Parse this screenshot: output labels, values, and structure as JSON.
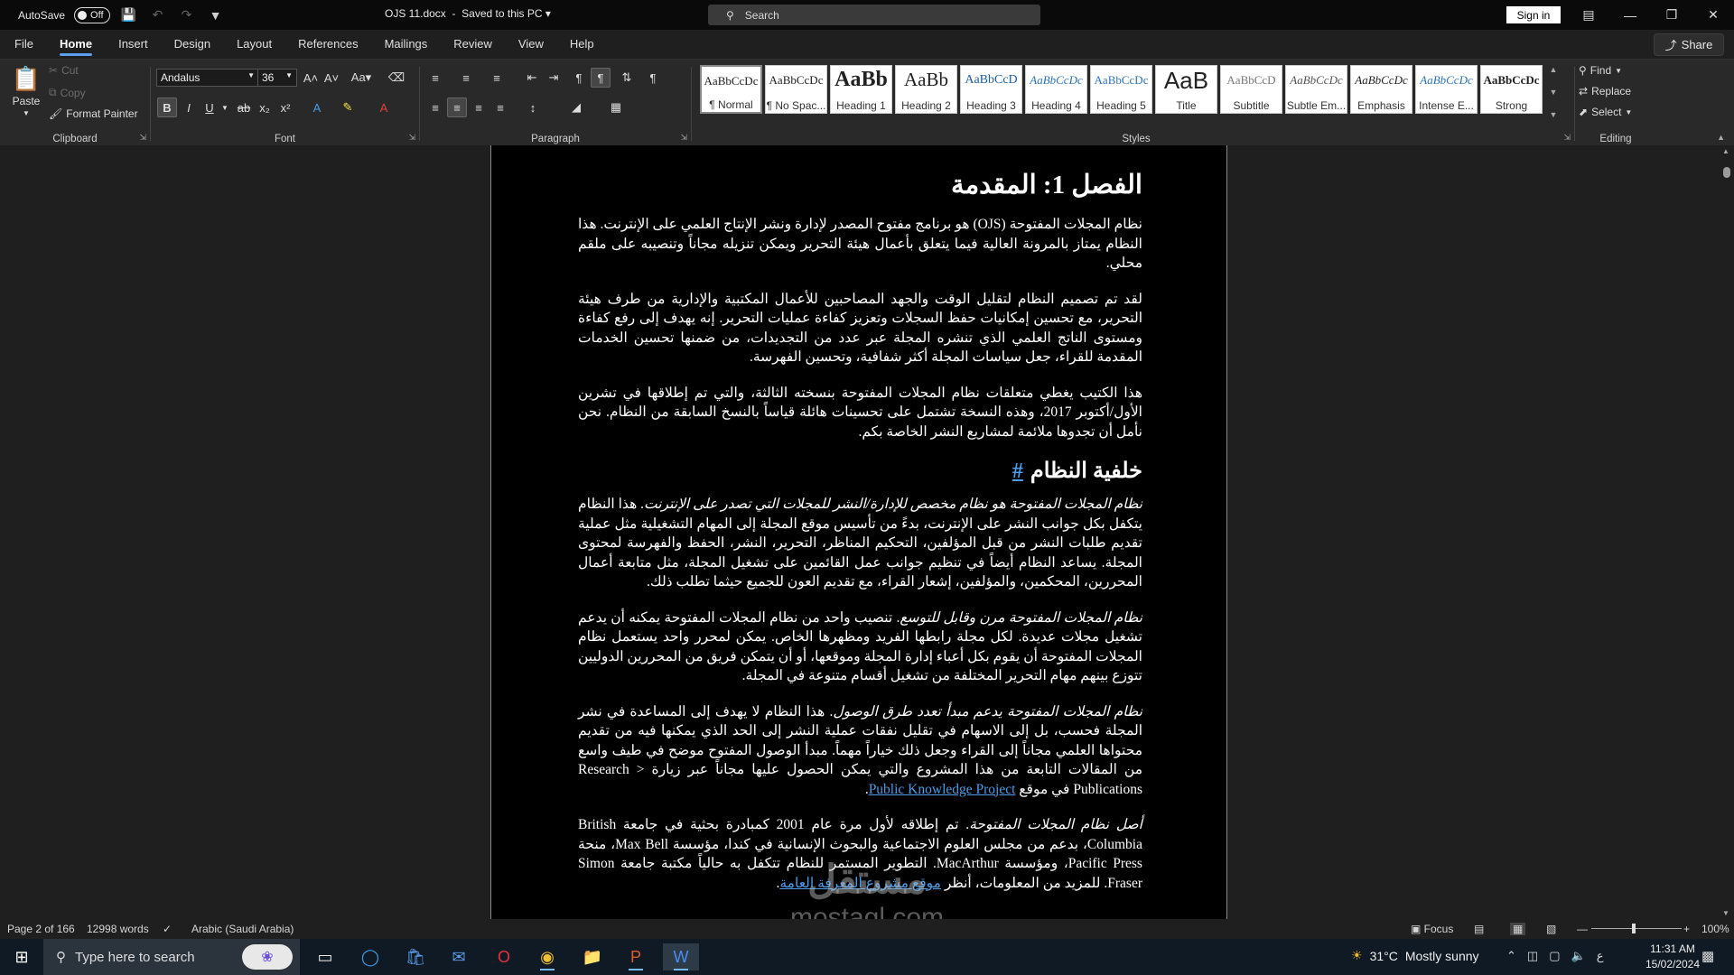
{
  "titlebar": {
    "autosave_label": "AutoSave",
    "autosave_state": "Off",
    "doc_title": "OJS 11.docx",
    "save_status": "Saved to this PC",
    "search_placeholder": "Search",
    "signin_label": "Sign in"
  },
  "tabs": [
    "File",
    "Home",
    "Insert",
    "Design",
    "Layout",
    "References",
    "Mailings",
    "Review",
    "View",
    "Help"
  ],
  "share_label": "Share",
  "ribbon": {
    "clipboard": {
      "label": "Clipboard",
      "paste": "Paste",
      "cut": "Cut",
      "copy": "Copy",
      "format_painter": "Format Painter"
    },
    "font": {
      "label": "Font",
      "family": "Andalus",
      "size": "36"
    },
    "paragraph": {
      "label": "Paragraph"
    },
    "styles": {
      "label": "Styles",
      "items": [
        {
          "preview": "AaBbCcDc",
          "name": "¶ Normal"
        },
        {
          "preview": "AaBbCcDc",
          "name": "¶ No Spac..."
        },
        {
          "preview": "AaBb",
          "name": "Heading 1"
        },
        {
          "preview": "AaBb",
          "name": "Heading 2"
        },
        {
          "preview": "AaBbCcD",
          "name": "Heading 3"
        },
        {
          "preview": "AaBbCcDc",
          "name": "Heading 4"
        },
        {
          "preview": "AaBbCcDc",
          "name": "Heading 5"
        },
        {
          "preview": "AaB",
          "name": "Title"
        },
        {
          "preview": "AaBbCcD",
          "name": "Subtitle"
        },
        {
          "preview": "AaBbCcDc",
          "name": "Subtle Em..."
        },
        {
          "preview": "AaBbCcDc",
          "name": "Emphasis"
        },
        {
          "preview": "AaBbCcDc",
          "name": "Intense E..."
        },
        {
          "preview": "AaBbCcDc",
          "name": "Strong"
        }
      ]
    },
    "editing": {
      "label": "Editing",
      "find": "Find",
      "replace": "Replace",
      "select": "Select"
    }
  },
  "document": {
    "heading1": "الفصل 1: المقدمة",
    "p1": "نظام المجلات المفتوحة (OJS) هو برنامج مفتوح المصدر لإدارة ونشر الإنتاج العلمي على الإنترنت. هذا النظام يمتاز بالمرونة العالية فيما يتعلق بأعمال هيئة التحرير ويمكن تنزيله مجاناً وتنصيبه على ملقم محلي.",
    "p2": "لقد تم تصميم النظام لتقليل الوقت والجهد المصاحبين للأعمال المكتبية والإدارية من طرف هيئة التحرير، مع تحسين إمكانيات حفظ السجلات وتعزيز كفاءة عمليات التحرير. إنه يهدف إلى رفع كفاءة ومستوى الناتج العلمي الذي تنشره المجلة عبر عدد من التجديدات، من ضمنها تحسين الخدمات المقدمة للقراء، جعل سياسات المجلة أكثر شفافية، وتحسين الفهرسة.",
    "p3": "هذا الكتيب يغطي متعلقات نظام المجلات المفتوحة بنسخته الثالثة، والتي تم إطلاقها في تشرين الأول/أكتوبر 2017، وهذه النسخة تشتمل على تحسينات هائلة قياساً بالنسخ السابقة من النظام. نحن نأمل أن تجدوها ملائمة لمشاريع النشر الخاصة بكم.",
    "heading2": "خلفية النظام",
    "heading2_anchor": "#",
    "p4_em": "نظام المجلات المفتوحة هو نظام مخصص للإدارة/النشر للمجلات التي تصدر على الإنترنت",
    "p4": ". هذا النظام يتكفل بكل جوانب النشر على الإنترنت، بدءً من تأسيس موقع المجلة إلى المهام التشغيلية مثل عملية تقديم طلبات النشر من قبل المؤلفين، التحكيم المناظر، التحرير، النشر، الحفظ والفهرسة لمحتوى المجلة. يساعد النظام أيضاً في تنظيم جوانب عمل القائمين على تشغيل المجلة، مثل متابعة أعمال المحررين، المحكمين، والمؤلفين، إشعار القراء، مع تقديم العون للجميع حيثما تطلب ذلك.",
    "p5_em": "نظام المجلات المفتوحة مرن وقابل للتوسع",
    "p5": ". تنصيب واحد من نظام المجلات المفتوحة يمكنه أن يدعم تشغيل مجلات عديدة. لكل مجلة رابطها الفريد ومظهرها الخاص. يمكن لمحرر واحد يستعمل نظام المجلات المفتوحة أن يقوم بكل أعباء إدارة المجلة وموقعها، أو أن يتمكن فريق من المحررين الدوليين تتوزع بينهم مهام التحرير المختلفة من تشغيل أقسام متنوعة في المجلة.",
    "p6_em": "نظام المجلات المفتوحة يدعم مبدأ تعدد طرق الوصول",
    "p6": ". هذا النظام لا يهدف إلى المساعدة في نشر المجلة فحسب، بل إلى الاسهام في تقليل نفقات عملية النشر إلى الحد الذي يمكنها فيه من تقديم محتواها العلمي مجاناً إلى القراء وجعل ذلك خياراً مهماً. مبدأ الوصول المفتوح موضح في طيف واسع من المقالات التابعة من هذا المشروع والتي يمكن الحصول عليها مجاناً عبر زيارة Research > Publications في موقع",
    "p6_link": "Public Knowledge Project",
    "p6_end": ".",
    "p7_em": "أصل نظام المجلات المفتوحة",
    "p7": ". تم إطلاقه لأول مرة عام 2001 كمبادرة بحثية في جامعة British Columbia، بدعم من مجلس العلوم الاجتماعية والبحوث الإنسانية في كندا، مؤسسة Max Bell، منحة Pacific Press، ومؤسسة MacArthur. التطوير المستمر للنظام تتكفل به حالياً مكتبة جامعة Simon Fraser. للمزيد من المعلومات، أنظر",
    "p7_link": "موقع مشروع المعرفة العامة",
    "p7_end": "."
  },
  "status": {
    "page": "Page 2 of 166",
    "words": "12998 words",
    "language": "Arabic (Saudi Arabia)",
    "focus": "Focus",
    "zoom": "100%"
  },
  "taskbar": {
    "search_placeholder": "Type here to search",
    "weather_temp": "31°C",
    "weather_desc": "Mostly sunny",
    "ime": "ع",
    "time": "11:31 AM",
    "date": "15/02/2024"
  },
  "watermark": {
    "logo_text": "مستقل",
    "site": "mostaql.com"
  }
}
